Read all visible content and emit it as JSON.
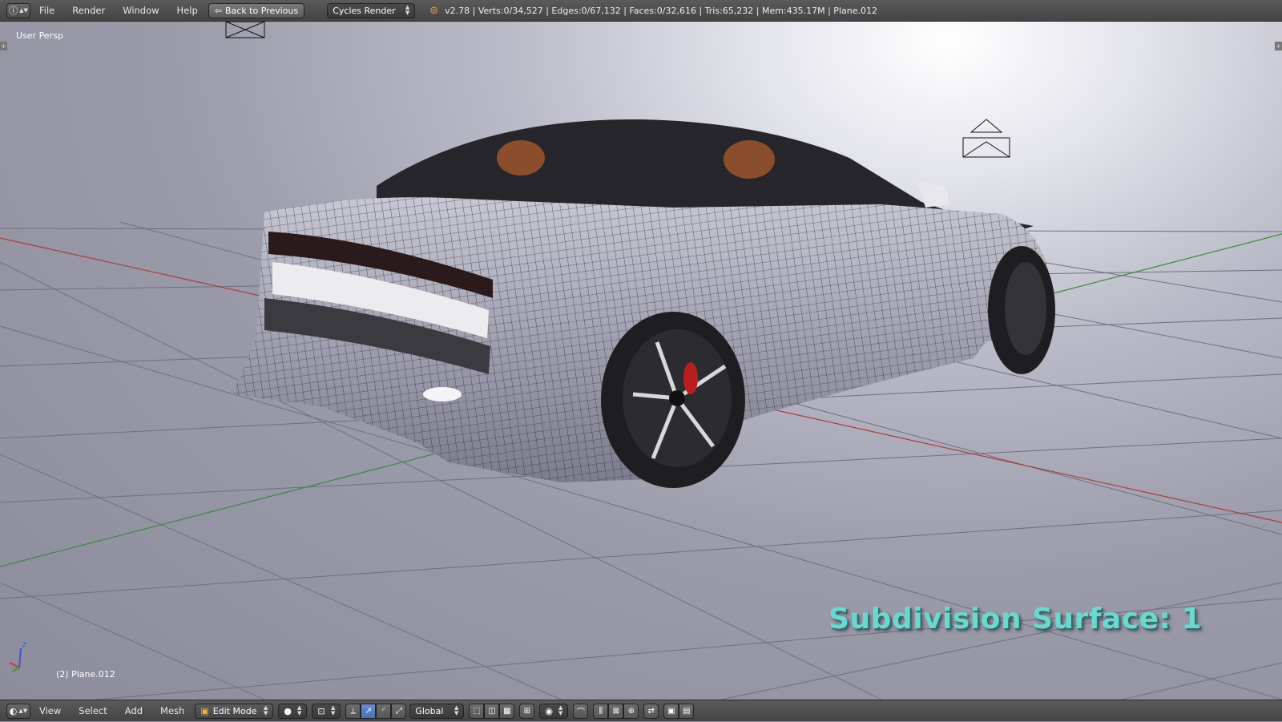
{
  "top_header": {
    "menu": [
      "File",
      "Render",
      "Window",
      "Help"
    ],
    "back_button": "Back to Previous",
    "render_engine": "Cycles Render",
    "stats": "v2.78 | Verts:0/34,527 | Edges:0/67,132 | Faces:0/32,616 | Tris:65,232 | Mem:435.17M | Plane.012"
  },
  "viewport": {
    "view_name": "User Persp",
    "object_name": "(2) Plane.012",
    "overlay_text": "Subdivision Surface: 1",
    "axis_z_label": "z"
  },
  "bottom_header": {
    "menu": [
      "View",
      "Select",
      "Add",
      "Mesh"
    ],
    "mode": "Edit Mode",
    "orientation": "Global"
  },
  "colors": {
    "overlay_text": "#6fd6cf",
    "x_axis": "#b03a3a",
    "y_axis": "#3a8a3a",
    "header_bg": "#4a4a4a",
    "active_button": "#5a7fc4"
  },
  "icons": [
    "info-icon",
    "blender-logo-icon",
    "back-arrow-icon",
    "view3d-icon",
    "edit-mode-icon",
    "viewport-shading-icon",
    "pivot-icon",
    "manipulator-translate-icon",
    "manipulator-rotate-icon",
    "manipulator-scale-icon",
    "vertex-select-icon",
    "edge-select-icon",
    "face-select-icon",
    "occlude-geometry-icon",
    "proportional-edit-icon",
    "snap-icon",
    "render-icon",
    "camera-icon"
  ]
}
